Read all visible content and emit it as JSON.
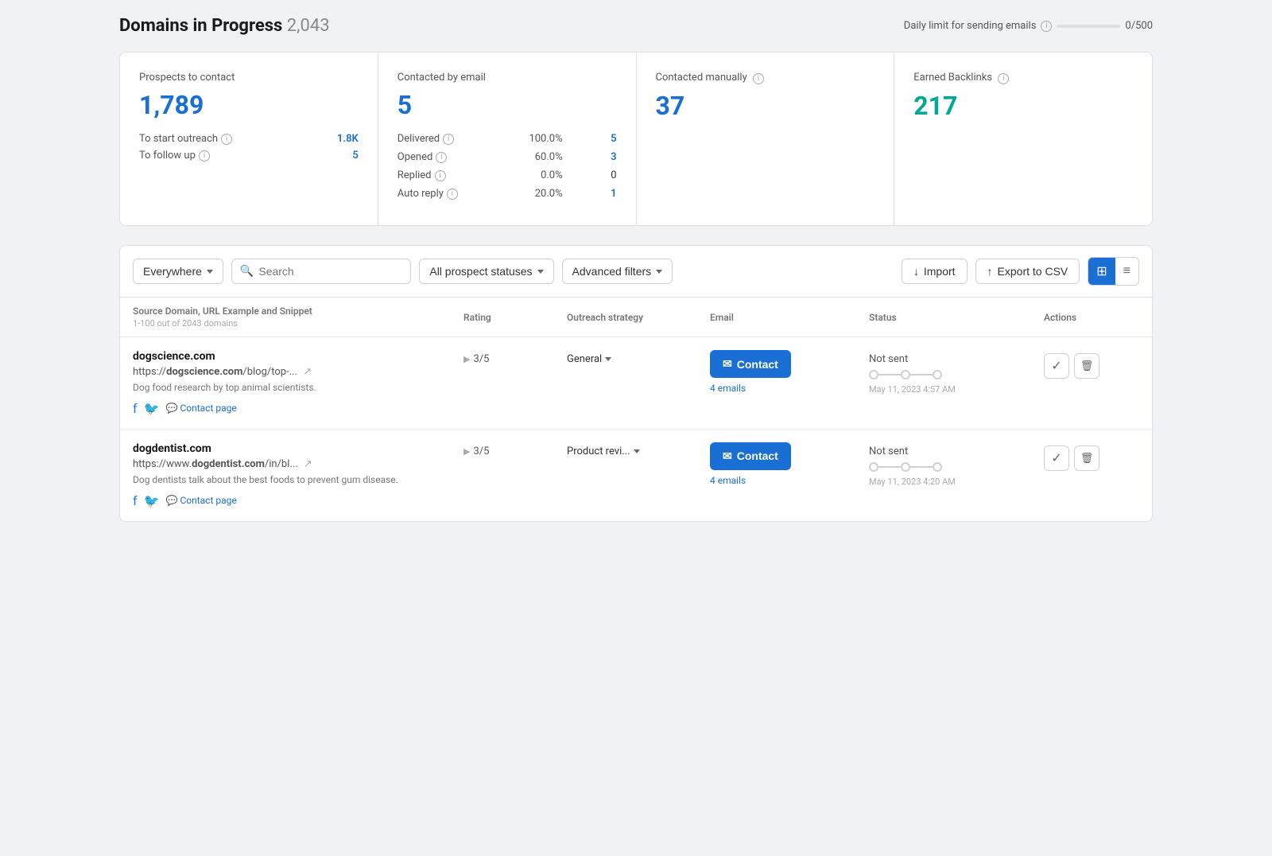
{
  "page": {
    "title": "Domains in Progress",
    "count": "2,043",
    "daily_limit_label": "Daily limit for sending emails",
    "daily_limit_value": "0/500"
  },
  "stats": {
    "prospects": {
      "label": "Prospects to contact",
      "value": "1,789",
      "rows": [
        {
          "label": "To start outreach",
          "value": "1.8K"
        },
        {
          "label": "To follow up",
          "value": "5"
        }
      ]
    },
    "email": {
      "label": "Contacted by email",
      "value": "5",
      "rows": [
        {
          "label": "Delivered",
          "pct": "100.0%",
          "count": "5"
        },
        {
          "label": "Opened",
          "pct": "60.0%",
          "count": "3"
        },
        {
          "label": "Replied",
          "pct": "0.0%",
          "count": "0"
        },
        {
          "label": "Auto reply",
          "pct": "20.0%",
          "count": "1"
        }
      ]
    },
    "manual": {
      "label": "Contacted manually",
      "value": "37"
    },
    "backlinks": {
      "label": "Earned Backlinks",
      "value": "217"
    }
  },
  "filters": {
    "location_label": "Everywhere",
    "search_placeholder": "Search",
    "status_label": "All prospect statuses",
    "advanced_label": "Advanced filters",
    "import_label": "Import",
    "export_label": "Export to CSV"
  },
  "table": {
    "columns": [
      "Source Domain, URL Example and Snippet",
      "Rating",
      "Outreach strategy",
      "Email",
      "Status",
      "Actions"
    ],
    "sub_label": "1-100 out of 2043 domains",
    "rows": [
      {
        "domain": "dogscience.com",
        "url": "https://dogscience.com/blog/top-...",
        "url_display_bold": "dogscience.com",
        "url_suffix": "/blog/top-...",
        "snippet": "Dog food research by top animal scientists.",
        "rating": "3/5",
        "outreach": "General",
        "contact_btn": "Contact",
        "emails": "4 emails",
        "status": "Not sent",
        "date": "May 11, 2023 4:57 AM"
      },
      {
        "domain": "dogdentist.com",
        "url": "https://www.dogdentist.com/in/bl...",
        "url_display_bold": "dogdentist.com",
        "url_suffix": "/in/bl...",
        "snippet": "Dog dentists talk about the best foods to prevent gum disease.",
        "rating": "3/5",
        "outreach": "Product revi...",
        "contact_btn": "Contact",
        "emails": "4 emails",
        "status": "Not sent",
        "date": "May 11, 2023 4:20 AM"
      }
    ]
  }
}
